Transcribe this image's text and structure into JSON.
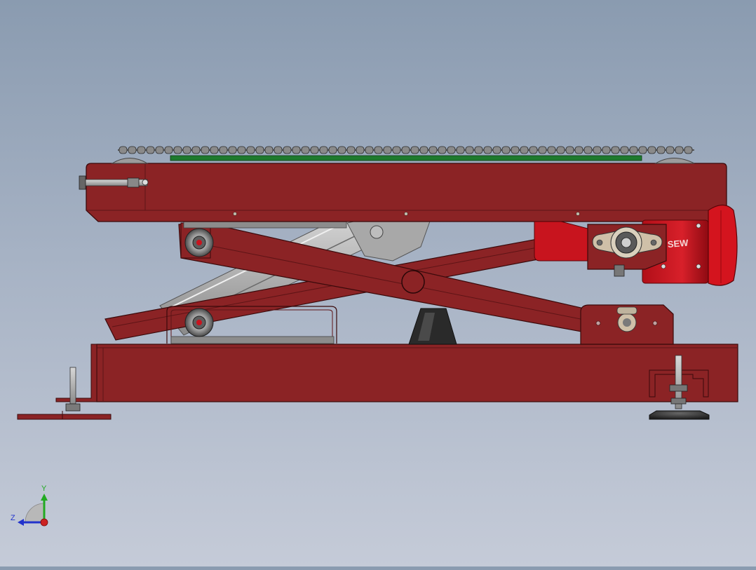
{
  "viewport": {
    "model": "scissor-lift-conveyor",
    "view": "side-view"
  },
  "triad": {
    "y_label": "Y",
    "z_label": "Z",
    "y_color": "#22aa22",
    "z_color": "#2233cc",
    "x_color": "#cc2222"
  },
  "motor": {
    "brand_text": "SEW"
  },
  "colors": {
    "frame": "#8b2325",
    "frame_dark": "#5e1416",
    "motor": "#c8141e",
    "belt": "#1e7a2e",
    "steel": "#9a9a9a"
  }
}
